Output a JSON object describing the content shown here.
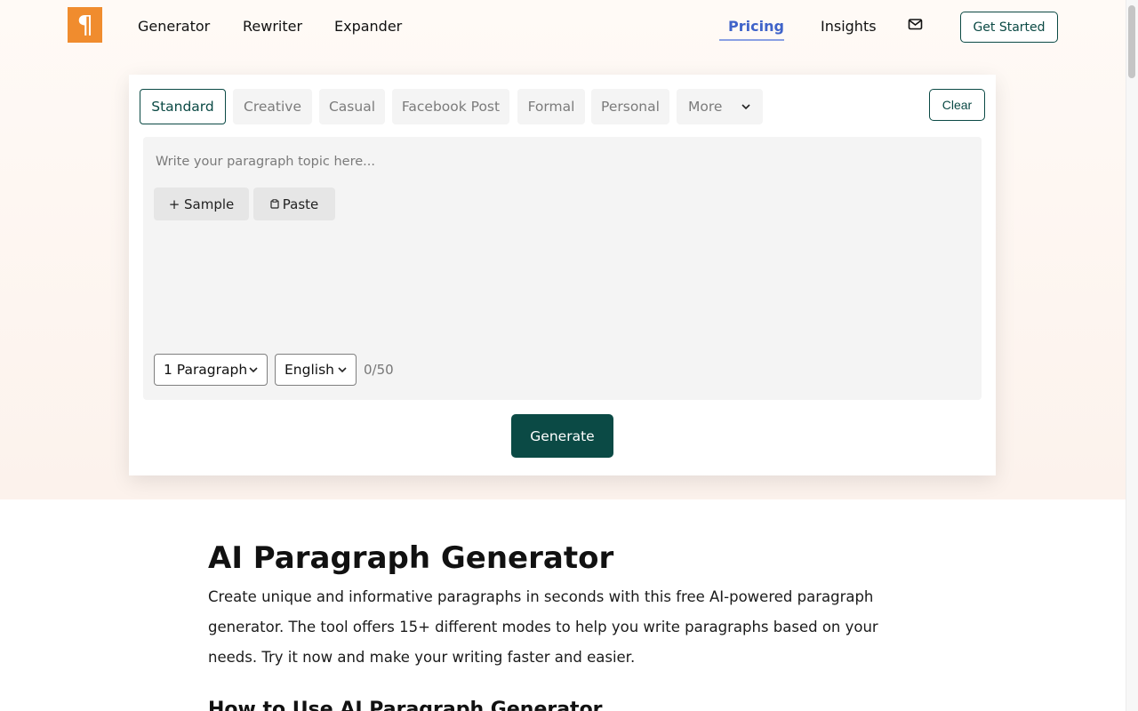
{
  "header": {
    "logo_icon": "pilcrow-icon",
    "logo_color": "#f08c2e",
    "nav": [
      "Generator",
      "Rewriter",
      "Expander"
    ],
    "pricing": "Pricing",
    "insights": "Insights",
    "mail_icon": "envelope-icon",
    "get_started": "Get Started"
  },
  "tool": {
    "modes": [
      "Standard",
      "Creative",
      "Casual",
      "Facebook Post",
      "Formal",
      "Personal"
    ],
    "active_mode": "Standard",
    "more_label": "More",
    "clear_label": "Clear",
    "topic_placeholder": "Write your paragraph topic here...",
    "sample_label": "+ Sample",
    "paste_label": "Paste",
    "paragraph_select": "1 Paragraph",
    "language_select": "English",
    "counter": "0/50",
    "generate_label": "Generate",
    "accent_color": "#0b4a45"
  },
  "article": {
    "title": "AI Paragraph Generator",
    "intro": "Create unique and informative paragraphs in seconds with this free AI-powered paragraph generator. The tool offers 15+ different modes to help you write paragraphs based on your needs. Try it now and make your writing faster and easier.",
    "how_to_title": "How to Use AI Paragraph Generator"
  }
}
